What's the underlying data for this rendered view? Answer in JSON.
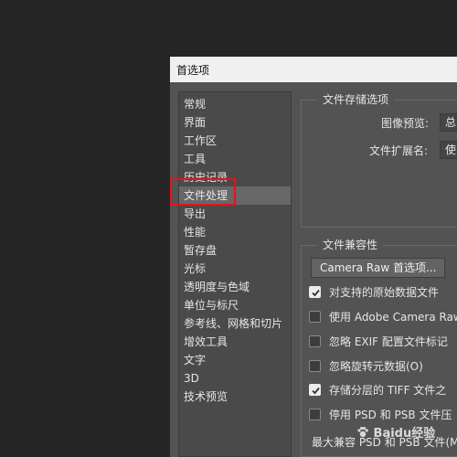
{
  "dialog": {
    "title": "首选项"
  },
  "sidebar": {
    "items": [
      {
        "label": "常规"
      },
      {
        "label": "界面"
      },
      {
        "label": "工作区"
      },
      {
        "label": "工具"
      },
      {
        "label": "历史记录"
      },
      {
        "label": "文件处理",
        "selected": true
      },
      {
        "label": "导出"
      },
      {
        "label": "性能"
      },
      {
        "label": "暂存盘"
      },
      {
        "label": "光标"
      },
      {
        "label": "透明度与色域"
      },
      {
        "label": "单位与标尺"
      },
      {
        "label": "参考线、网格和切片"
      },
      {
        "label": "增效工具"
      },
      {
        "label": "文字"
      },
      {
        "label": "3D"
      },
      {
        "label": "技术预览"
      }
    ]
  },
  "file_save_options": {
    "legend": "文件存储选项",
    "image_preview_label": "图像预览:",
    "image_preview_value": "总",
    "file_extension_label": "文件扩展名:",
    "file_extension_value": "使"
  },
  "file_compat": {
    "legend": "文件兼容性",
    "camera_raw_button": "Camera Raw 首选项...",
    "options": [
      {
        "label": "对支持的原始数据文件",
        "checked": true
      },
      {
        "label": "使用 Adobe Camera Raw",
        "checked": false
      },
      {
        "label": "忽略 EXIF 配置文件标记",
        "checked": false
      },
      {
        "label": "忽略旋转元数据(O)",
        "checked": false
      },
      {
        "label": "存储分层的 TIFF 文件之",
        "checked": true
      },
      {
        "label": "停用 PSD 和 PSB 文件压",
        "checked": false
      }
    ],
    "max_compat_label": "最大兼容 PSD 和 PSB 文件(M"
  },
  "watermark": {
    "text": "Baidu经验"
  },
  "colors": {
    "highlight": "#e8101a",
    "dialog_bg": "#535353",
    "titlebar_bg": "#f0f0f0",
    "selected_item_bg": "#676767"
  }
}
